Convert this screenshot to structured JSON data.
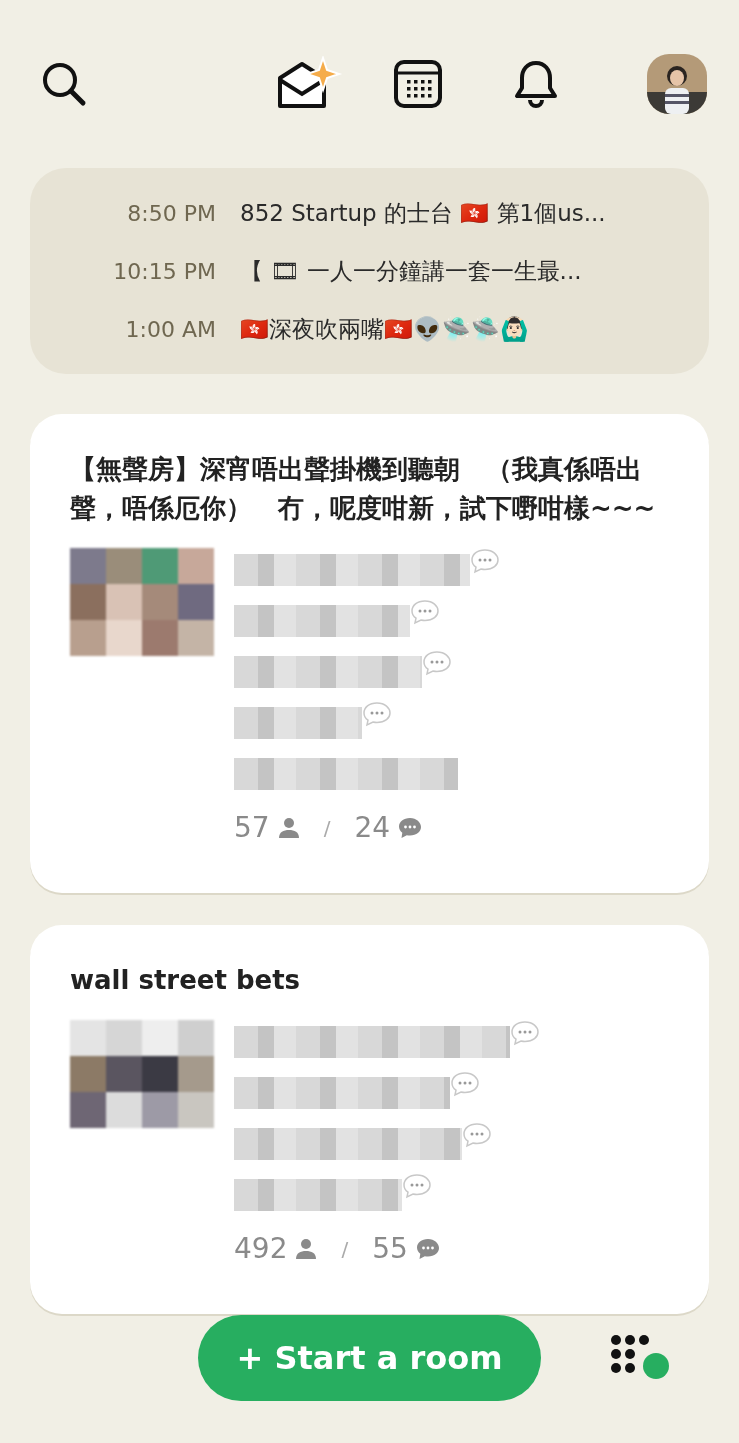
{
  "upcoming": [
    {
      "time": "8:50 PM",
      "title": "852 Startup 的士台 🇭🇰 第1個us..."
    },
    {
      "time": "10:15 PM",
      "title": "【 🎞 一人一分鐘講一套一生最..."
    },
    {
      "time": "1:00 AM",
      "title": "🇭🇰深夜吹兩嘴🇭🇰👽🛸🛸🙆🏻‍♂️"
    }
  ],
  "rooms": [
    {
      "title": "【無聲房】深宵唔出聲掛機到聽朝　（我真係唔出聲，唔係厄你）　冇，呢度咁新，試下嘢咁樣~~~",
      "speakers": [
        {
          "speaking": true
        },
        {
          "speaking": true
        },
        {
          "speaking": true
        },
        {
          "speaking": true
        },
        {
          "speaking": false
        }
      ],
      "listeners": "57",
      "separator": "/",
      "chats": "24"
    },
    {
      "title": "wall street bets",
      "speakers": [
        {
          "speaking": true
        },
        {
          "speaking": true
        },
        {
          "speaking": true
        },
        {
          "speaking": true
        }
      ],
      "listeners": "492",
      "separator": "/",
      "chats": "55"
    }
  ],
  "start_button": {
    "label": "+ Start a room"
  }
}
